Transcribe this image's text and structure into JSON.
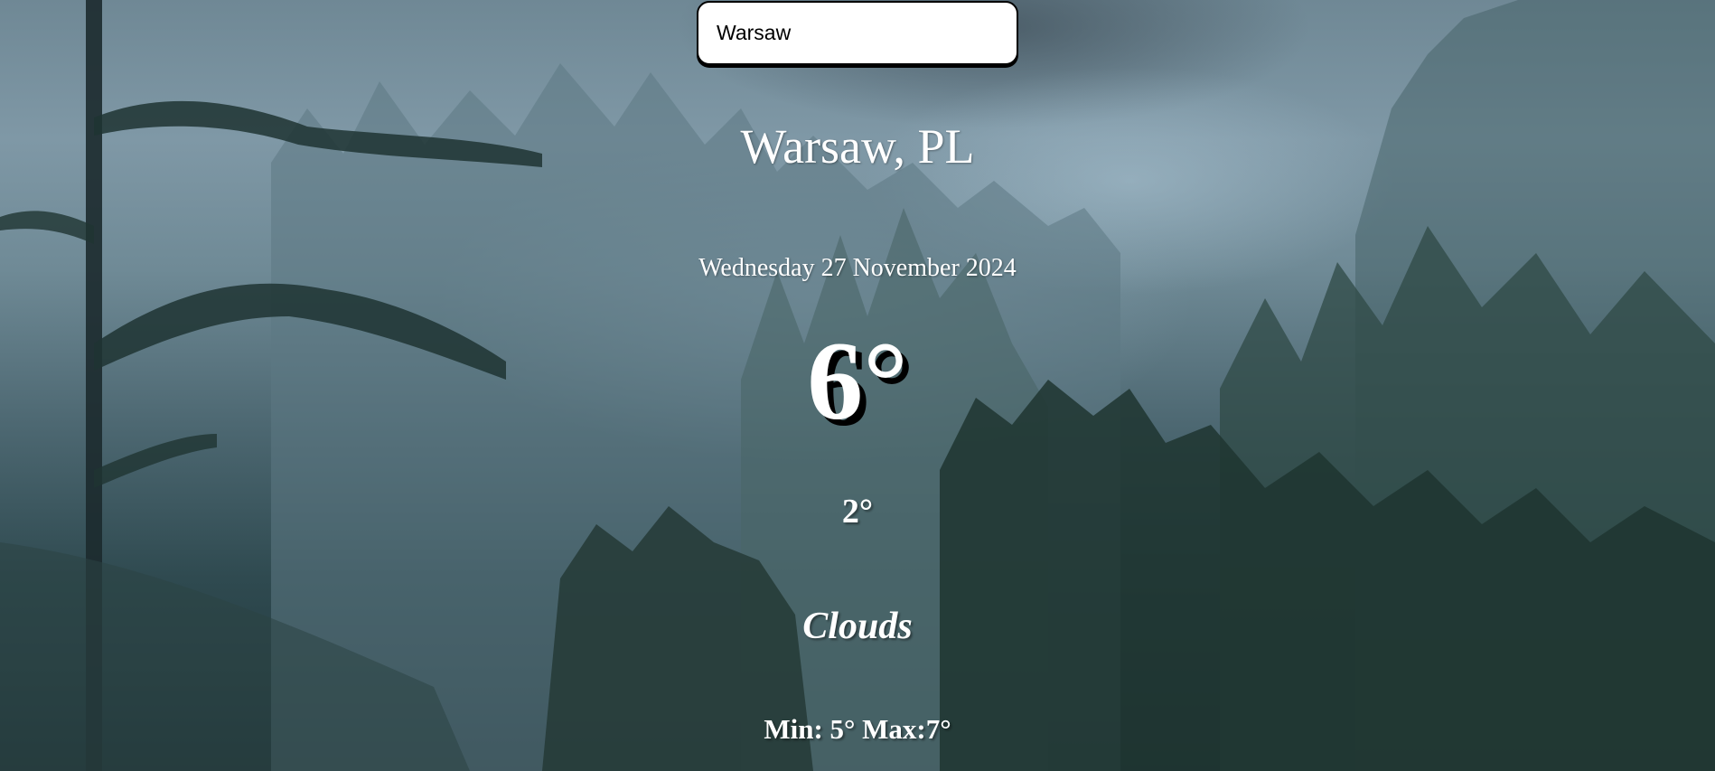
{
  "search": {
    "value": "Warsaw"
  },
  "weather": {
    "location": "Warsaw, PL",
    "date": "Wednesday 27 November 2024",
    "temperature": "6°",
    "feels_like": "2°",
    "condition": "Clouds",
    "min_max": "Min: 5° Max:7°"
  },
  "colors": {
    "text": "#ffffff",
    "search_bg": "#ffffff",
    "search_border": "#000000"
  }
}
